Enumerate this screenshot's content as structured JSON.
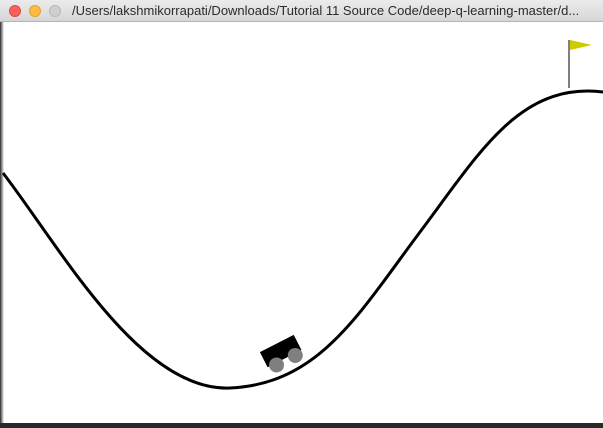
{
  "window": {
    "title": "/Users/lakshmikorrapati/Downloads/Tutorial 11 Source Code/deep-q-learning-master/d..."
  },
  "controls": {
    "close_icon": "close-icon",
    "minimize_icon": "minimize-icon",
    "maximize_icon": "maximize-icon"
  },
  "scene": {
    "track_color": "#000000",
    "car_color": "#000000",
    "wheel_color": "#7f7f7f",
    "flag_color": "#cccc00",
    "flagpole_color": "#000000",
    "icons": [
      "car-icon",
      "flag-icon"
    ]
  }
}
